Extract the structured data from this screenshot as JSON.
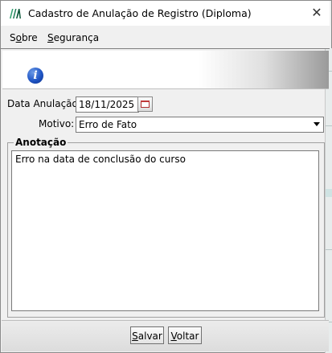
{
  "window": {
    "title": "Cadastro de Anulação de Registro (Diploma)",
    "close_glyph": "✕"
  },
  "menu": {
    "items": [
      {
        "label_first": "S",
        "label_mnemonic": "o",
        "label_rest": "bre"
      },
      {
        "label_first": "",
        "label_mnemonic": "S",
        "label_rest": "egurança"
      }
    ]
  },
  "banner": {
    "icon": "info-icon",
    "glyph": "i"
  },
  "form": {
    "date_label": "Data Anulação:",
    "date_value": "18/11/2025",
    "motivo_label": "Motivo:",
    "motivo_value": "Erro de Fato",
    "anotacao_legend": "Anotação",
    "anotacao_text": "Erro na data de conclusão do curso"
  },
  "buttons": {
    "save_mnemonic": "S",
    "save_rest": "alvar",
    "back_mnemonic": "V",
    "back_rest": "oltar"
  },
  "colors": {
    "info_icon": "#1f55c5",
    "calendar_icon": "#c03a3a"
  }
}
